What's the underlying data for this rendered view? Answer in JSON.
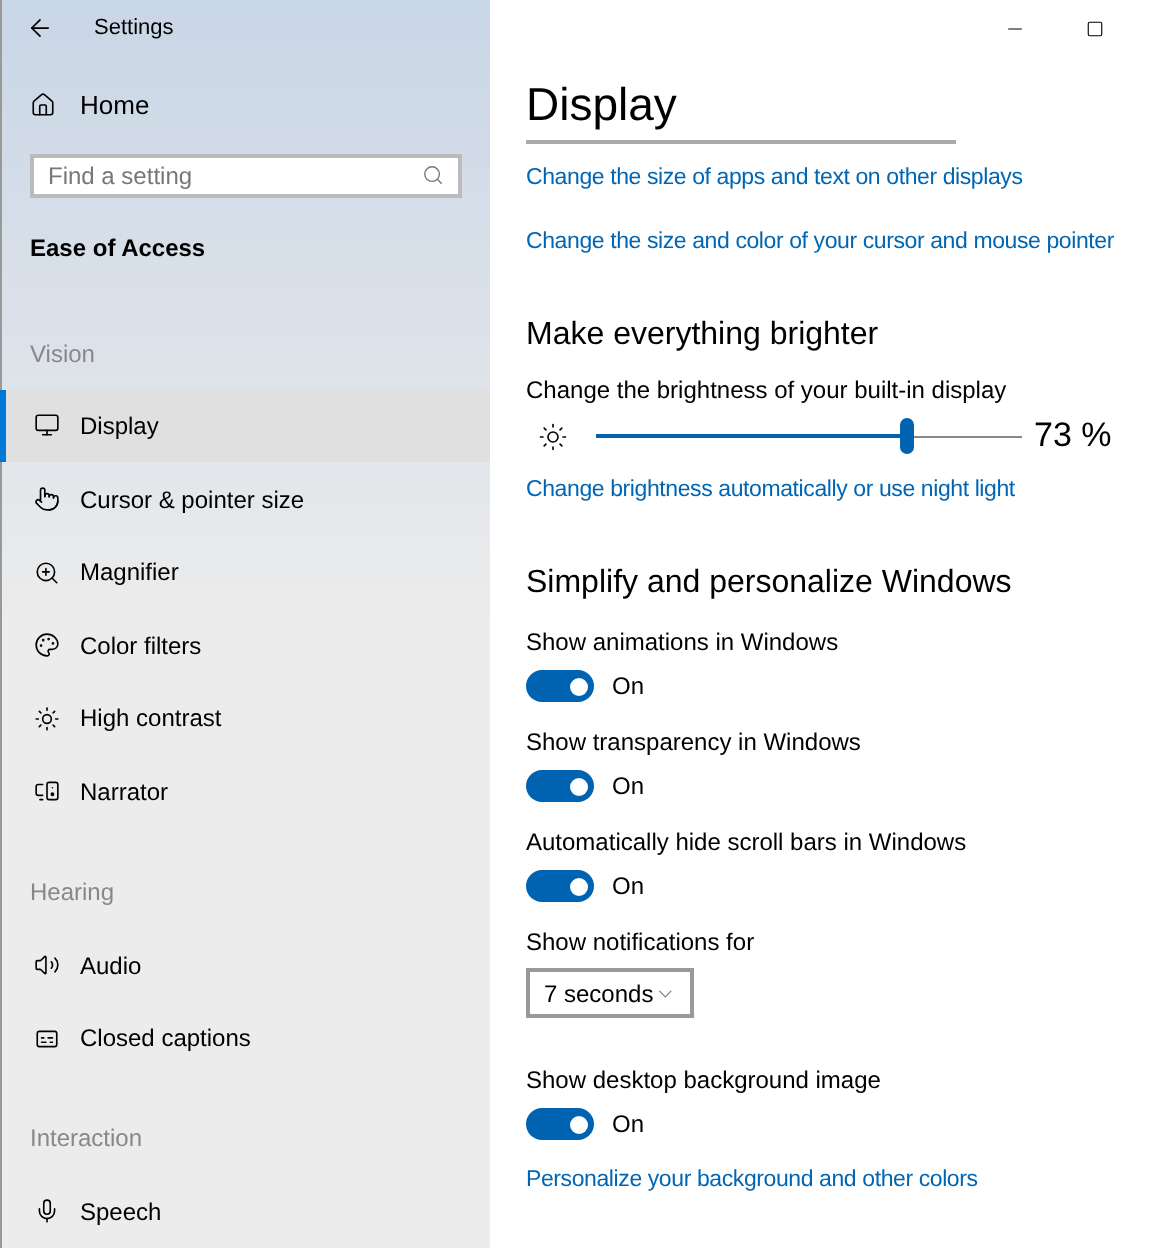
{
  "window": {
    "title": "Settings"
  },
  "sidebar": {
    "home": "Home",
    "search": {
      "placeholder": "Find a setting"
    },
    "category": "Ease of Access",
    "items": [
      {
        "kind": "section",
        "label": "Vision"
      },
      {
        "kind": "item",
        "label": "Display",
        "selected": true
      },
      {
        "kind": "item",
        "label": "Cursor & pointer size",
        "selected": false
      },
      {
        "kind": "item",
        "label": "Magnifier",
        "selected": false
      },
      {
        "kind": "item",
        "label": "Color filters",
        "selected": false
      },
      {
        "kind": "item",
        "label": "High contrast",
        "selected": false
      },
      {
        "kind": "item",
        "label": "Narrator",
        "selected": false
      },
      {
        "kind": "section",
        "label": "Hearing"
      },
      {
        "kind": "item",
        "label": "Audio",
        "selected": false
      },
      {
        "kind": "item",
        "label": "Closed captions",
        "selected": false
      },
      {
        "kind": "section",
        "label": "Interaction"
      },
      {
        "kind": "item",
        "label": "Speech",
        "selected": false
      }
    ]
  },
  "page": {
    "title": "Display",
    "blocks": [
      {
        "kind": "link",
        "text": "Change the size of apps and text on other displays"
      },
      {
        "kind": "link",
        "text": "Change the size and color of your cursor and mouse pointer"
      },
      {
        "kind": "heading",
        "text": "Make everything brighter"
      },
      {
        "kind": "slider",
        "label": "Change the brightness of your built-in display",
        "level": 0.73,
        "reading": "73 %"
      },
      {
        "kind": "link",
        "text": "Change brightness automatically or use night light"
      },
      {
        "kind": "heading",
        "text": "Simplify and personalize Windows"
      },
      {
        "kind": "toggle",
        "label": "Show animations in Windows",
        "on": true,
        "state": "On"
      },
      {
        "kind": "toggle",
        "label": "Show transparency in Windows",
        "on": true,
        "state": "On"
      },
      {
        "kind": "toggle",
        "label": "Automatically hide scroll bars in Windows",
        "on": true,
        "state": "On"
      },
      {
        "kind": "dropdown",
        "label": "Show notifications for",
        "value": "7 seconds"
      },
      {
        "kind": "toggle",
        "label": "Show desktop background image",
        "on": true,
        "state": "On"
      },
      {
        "kind": "link",
        "text": "Personalize your background and other colors"
      }
    ]
  }
}
